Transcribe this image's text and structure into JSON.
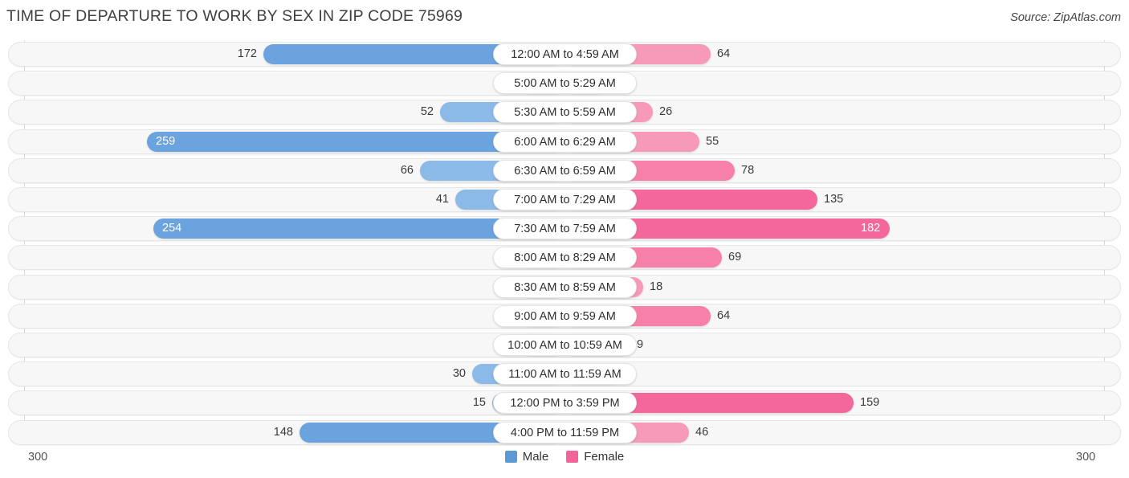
{
  "header": {
    "title": "TIME OF DEPARTURE TO WORK BY SEX IN ZIP CODE 75969",
    "source": "Source: ZipAtlas.com"
  },
  "axis": {
    "left_max": "300",
    "right_max": "300"
  },
  "legend": {
    "items": [
      {
        "label": "Male",
        "color": "#5b9bd5"
      },
      {
        "label": "Female",
        "color": "#f2639a"
      }
    ]
  },
  "colors": {
    "male_strong": "#6aa3dd",
    "male_mid": "#8bb9e8",
    "male_light": "#a9caee",
    "female_strong": "#f4679a",
    "female_mid": "#f780ab",
    "female_light": "#f79ab9",
    "track": "#f7f7f7",
    "gridline": "#d8d8d8"
  },
  "chart_data": {
    "type": "bar",
    "title": "TIME OF DEPARTURE TO WORK BY SEX IN ZIP CODE 75969",
    "xlabel": "",
    "ylabel": "",
    "orientation": "horizontal-diverging",
    "axis_max": 300,
    "categories": [
      "12:00 AM to 4:59 AM",
      "5:00 AM to 5:29 AM",
      "5:30 AM to 5:59 AM",
      "6:00 AM to 6:29 AM",
      "6:30 AM to 6:59 AM",
      "7:00 AM to 7:29 AM",
      "7:30 AM to 7:59 AM",
      "8:00 AM to 8:29 AM",
      "8:30 AM to 8:59 AM",
      "9:00 AM to 9:59 AM",
      "10:00 AM to 10:59 AM",
      "11:00 AM to 11:59 AM",
      "12:00 PM to 3:59 PM",
      "4:00 PM to 11:59 PM"
    ],
    "series": [
      {
        "name": "Male",
        "direction": "left",
        "color": "#5b9bd5",
        "values": [
          172,
          0,
          52,
          259,
          66,
          41,
          254,
          0,
          0,
          0,
          0,
          30,
          15,
          148
        ]
      },
      {
        "name": "Female",
        "direction": "right",
        "color": "#f2639a",
        "values": [
          64,
          0,
          26,
          55,
          78,
          135,
          182,
          69,
          18,
          64,
          9,
          0,
          159,
          46
        ]
      }
    ],
    "legend_position": "bottom-center",
    "grid": true
  },
  "rows": [
    {
      "label": "12:00 AM to 4:59 AM",
      "male": "172",
      "female": "64",
      "male_w": 375,
      "female_w": 182,
      "male_color": "#6aa3dd",
      "female_color": "#f79ab9",
      "male_inside": false,
      "female_inside": false
    },
    {
      "label": "5:00 AM to 5:29 AM",
      "male": "0",
      "female": "0",
      "male_w": 55,
      "female_w": 55,
      "male_color": "#a9caee",
      "female_color": "#f79ab9",
      "male_inside": false,
      "female_inside": false
    },
    {
      "label": "5:30 AM to 5:59 AM",
      "male": "52",
      "female": "26",
      "male_w": 155,
      "female_w": 110,
      "male_color": "#8bb9e8",
      "female_color": "#f79ab9",
      "male_inside": false,
      "female_inside": false
    },
    {
      "label": "6:00 AM to 6:29 AM",
      "male": "259",
      "female": "55",
      "male_w": 520,
      "female_w": 168,
      "male_color": "#6aa3dd",
      "female_color": "#f79ab9",
      "male_inside": true,
      "female_inside": false
    },
    {
      "label": "6:30 AM to 6:59 AM",
      "male": "66",
      "female": "78",
      "male_w": 180,
      "female_w": 212,
      "male_color": "#8bb9e8",
      "female_color": "#f780ab",
      "male_inside": false,
      "female_inside": false
    },
    {
      "label": "7:00 AM to 7:29 AM",
      "male": "41",
      "female": "135",
      "male_w": 136,
      "female_w": 315,
      "male_color": "#8bb9e8",
      "female_color": "#f4679a",
      "male_inside": false,
      "female_inside": false
    },
    {
      "label": "7:30 AM to 7:59 AM",
      "male": "254",
      "female": "182",
      "male_w": 512,
      "female_w": 405,
      "male_color": "#6aa3dd",
      "female_color": "#f4679a",
      "male_inside": true,
      "female_inside": true
    },
    {
      "label": "8:00 AM to 8:29 AM",
      "male": "0",
      "female": "69",
      "male_w": 55,
      "female_w": 196,
      "male_color": "#a9caee",
      "female_color": "#f780ab",
      "male_inside": false,
      "female_inside": false
    },
    {
      "label": "8:30 AM to 8:59 AM",
      "male": "0",
      "female": "18",
      "male_w": 55,
      "female_w": 98,
      "male_color": "#a9caee",
      "female_color": "#f79ab9",
      "male_inside": false,
      "female_inside": false
    },
    {
      "label": "9:00 AM to 9:59 AM",
      "male": "0",
      "female": "64",
      "male_w": 55,
      "female_w": 182,
      "male_color": "#a9caee",
      "female_color": "#f780ab",
      "male_inside": false,
      "female_inside": false
    },
    {
      "label": "10:00 AM to 10:59 AM",
      "male": "0",
      "female": "9",
      "male_w": 55,
      "female_w": 82,
      "male_color": "#a9caee",
      "female_color": "#f79ab9",
      "male_inside": false,
      "female_inside": false
    },
    {
      "label": "11:00 AM to 11:59 AM",
      "male": "30",
      "female": "0",
      "male_w": 115,
      "female_w": 72,
      "male_color": "#8bb9e8",
      "female_color": "#f79ab9",
      "male_inside": false,
      "female_inside": false
    },
    {
      "label": "12:00 PM to 3:59 PM",
      "male": "15",
      "female": "159",
      "male_w": 90,
      "female_w": 360,
      "male_color": "#8bb9e8",
      "female_color": "#f4679a",
      "male_inside": false,
      "female_inside": false
    },
    {
      "label": "4:00 PM to 11:59 PM",
      "male": "148",
      "female": "46",
      "male_w": 330,
      "female_w": 155,
      "male_color": "#6aa3dd",
      "female_color": "#f79ab9",
      "male_inside": false,
      "female_inside": false
    }
  ]
}
